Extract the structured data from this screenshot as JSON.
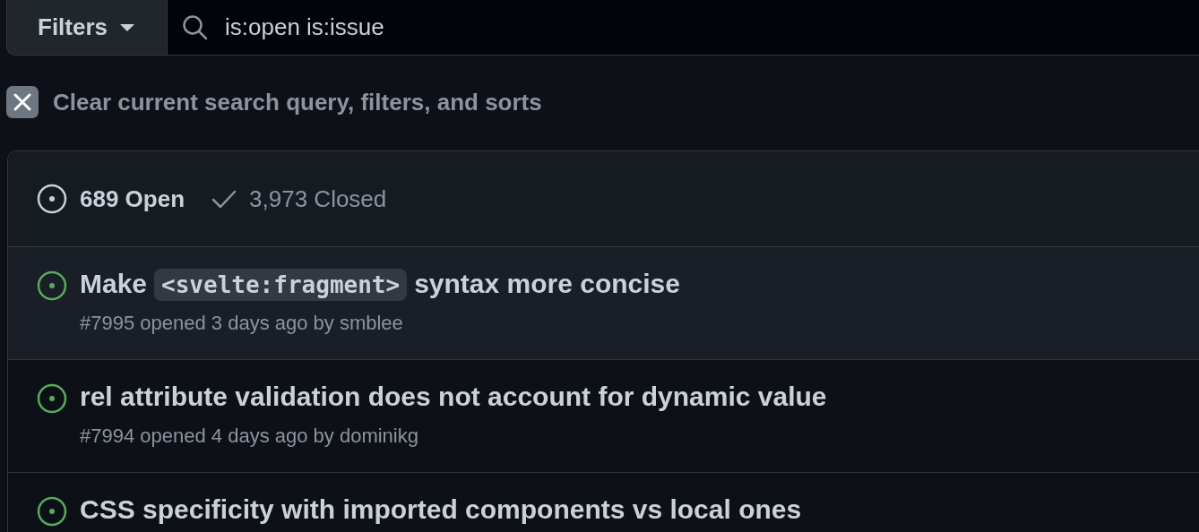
{
  "filter_bar": {
    "filters_button": "Filters",
    "search": {
      "value": "is:open is:issue"
    }
  },
  "clear_query": {
    "label": "Clear current search query, filters, and sorts"
  },
  "state_tabs": [
    {
      "label": "689 Open",
      "kind": "open",
      "selected": true
    },
    {
      "label": "3,973 Closed",
      "kind": "closed",
      "selected": false
    }
  ],
  "issues": [
    {
      "title": [
        {
          "kind": "text",
          "text": "Make"
        },
        {
          "kind": "code",
          "text": "<svelte:fragment>"
        },
        {
          "kind": "text",
          "text": "syntax more concise"
        }
      ],
      "meta": "#7995 opened 3 days ago by smblee",
      "hovered": true
    },
    {
      "title": [
        {
          "kind": "text",
          "text": "rel attribute validation does not account for dynamic value"
        }
      ],
      "meta": "#7994 opened 4 days ago by dominikg",
      "hovered": false
    },
    {
      "title": [
        {
          "kind": "text",
          "text": "CSS specificity with imported components vs local ones"
        }
      ],
      "hovered": false
    }
  ]
}
